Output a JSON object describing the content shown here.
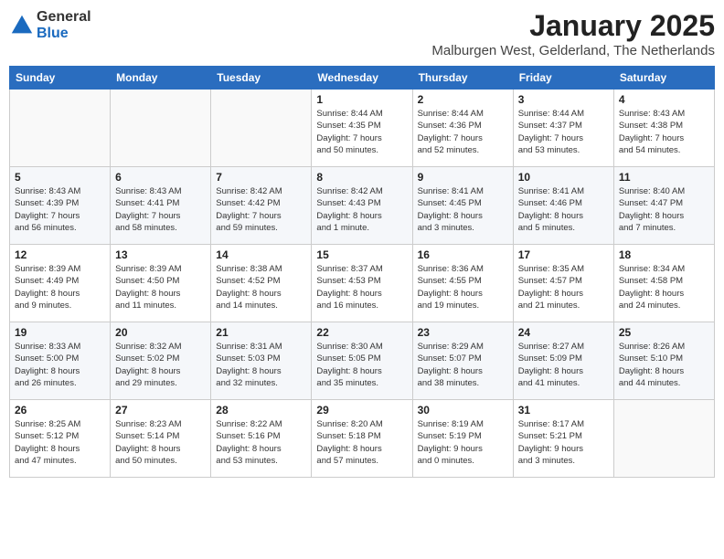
{
  "header": {
    "logo_general": "General",
    "logo_blue": "Blue",
    "month": "January 2025",
    "location": "Malburgen West, Gelderland, The Netherlands"
  },
  "weekdays": [
    "Sunday",
    "Monday",
    "Tuesday",
    "Wednesday",
    "Thursday",
    "Friday",
    "Saturday"
  ],
  "weeks": [
    [
      {
        "day": "",
        "info": ""
      },
      {
        "day": "",
        "info": ""
      },
      {
        "day": "",
        "info": ""
      },
      {
        "day": "1",
        "info": "Sunrise: 8:44 AM\nSunset: 4:35 PM\nDaylight: 7 hours\nand 50 minutes."
      },
      {
        "day": "2",
        "info": "Sunrise: 8:44 AM\nSunset: 4:36 PM\nDaylight: 7 hours\nand 52 minutes."
      },
      {
        "day": "3",
        "info": "Sunrise: 8:44 AM\nSunset: 4:37 PM\nDaylight: 7 hours\nand 53 minutes."
      },
      {
        "day": "4",
        "info": "Sunrise: 8:43 AM\nSunset: 4:38 PM\nDaylight: 7 hours\nand 54 minutes."
      }
    ],
    [
      {
        "day": "5",
        "info": "Sunrise: 8:43 AM\nSunset: 4:39 PM\nDaylight: 7 hours\nand 56 minutes."
      },
      {
        "day": "6",
        "info": "Sunrise: 8:43 AM\nSunset: 4:41 PM\nDaylight: 7 hours\nand 58 minutes."
      },
      {
        "day": "7",
        "info": "Sunrise: 8:42 AM\nSunset: 4:42 PM\nDaylight: 7 hours\nand 59 minutes."
      },
      {
        "day": "8",
        "info": "Sunrise: 8:42 AM\nSunset: 4:43 PM\nDaylight: 8 hours\nand 1 minute."
      },
      {
        "day": "9",
        "info": "Sunrise: 8:41 AM\nSunset: 4:45 PM\nDaylight: 8 hours\nand 3 minutes."
      },
      {
        "day": "10",
        "info": "Sunrise: 8:41 AM\nSunset: 4:46 PM\nDaylight: 8 hours\nand 5 minutes."
      },
      {
        "day": "11",
        "info": "Sunrise: 8:40 AM\nSunset: 4:47 PM\nDaylight: 8 hours\nand 7 minutes."
      }
    ],
    [
      {
        "day": "12",
        "info": "Sunrise: 8:39 AM\nSunset: 4:49 PM\nDaylight: 8 hours\nand 9 minutes."
      },
      {
        "day": "13",
        "info": "Sunrise: 8:39 AM\nSunset: 4:50 PM\nDaylight: 8 hours\nand 11 minutes."
      },
      {
        "day": "14",
        "info": "Sunrise: 8:38 AM\nSunset: 4:52 PM\nDaylight: 8 hours\nand 14 minutes."
      },
      {
        "day": "15",
        "info": "Sunrise: 8:37 AM\nSunset: 4:53 PM\nDaylight: 8 hours\nand 16 minutes."
      },
      {
        "day": "16",
        "info": "Sunrise: 8:36 AM\nSunset: 4:55 PM\nDaylight: 8 hours\nand 19 minutes."
      },
      {
        "day": "17",
        "info": "Sunrise: 8:35 AM\nSunset: 4:57 PM\nDaylight: 8 hours\nand 21 minutes."
      },
      {
        "day": "18",
        "info": "Sunrise: 8:34 AM\nSunset: 4:58 PM\nDaylight: 8 hours\nand 24 minutes."
      }
    ],
    [
      {
        "day": "19",
        "info": "Sunrise: 8:33 AM\nSunset: 5:00 PM\nDaylight: 8 hours\nand 26 minutes."
      },
      {
        "day": "20",
        "info": "Sunrise: 8:32 AM\nSunset: 5:02 PM\nDaylight: 8 hours\nand 29 minutes."
      },
      {
        "day": "21",
        "info": "Sunrise: 8:31 AM\nSunset: 5:03 PM\nDaylight: 8 hours\nand 32 minutes."
      },
      {
        "day": "22",
        "info": "Sunrise: 8:30 AM\nSunset: 5:05 PM\nDaylight: 8 hours\nand 35 minutes."
      },
      {
        "day": "23",
        "info": "Sunrise: 8:29 AM\nSunset: 5:07 PM\nDaylight: 8 hours\nand 38 minutes."
      },
      {
        "day": "24",
        "info": "Sunrise: 8:27 AM\nSunset: 5:09 PM\nDaylight: 8 hours\nand 41 minutes."
      },
      {
        "day": "25",
        "info": "Sunrise: 8:26 AM\nSunset: 5:10 PM\nDaylight: 8 hours\nand 44 minutes."
      }
    ],
    [
      {
        "day": "26",
        "info": "Sunrise: 8:25 AM\nSunset: 5:12 PM\nDaylight: 8 hours\nand 47 minutes."
      },
      {
        "day": "27",
        "info": "Sunrise: 8:23 AM\nSunset: 5:14 PM\nDaylight: 8 hours\nand 50 minutes."
      },
      {
        "day": "28",
        "info": "Sunrise: 8:22 AM\nSunset: 5:16 PM\nDaylight: 8 hours\nand 53 minutes."
      },
      {
        "day": "29",
        "info": "Sunrise: 8:20 AM\nSunset: 5:18 PM\nDaylight: 8 hours\nand 57 minutes."
      },
      {
        "day": "30",
        "info": "Sunrise: 8:19 AM\nSunset: 5:19 PM\nDaylight: 9 hours\nand 0 minutes."
      },
      {
        "day": "31",
        "info": "Sunrise: 8:17 AM\nSunset: 5:21 PM\nDaylight: 9 hours\nand 3 minutes."
      },
      {
        "day": "",
        "info": ""
      }
    ]
  ]
}
